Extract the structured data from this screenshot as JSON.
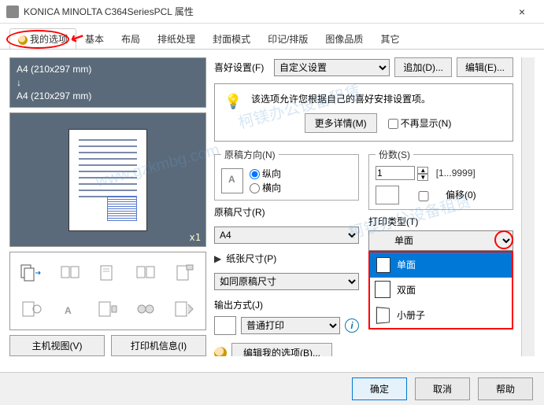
{
  "window": {
    "title": "KONICA MINOLTA C364SeriesPCL 属性",
    "close": "×"
  },
  "tabs": [
    "我的选项",
    "基本",
    "布局",
    "排纸处理",
    "封面模式",
    "印记/排版",
    "图像品质",
    "其它"
  ],
  "active_tab": 0,
  "preview": {
    "line1": "A4 (210x297 mm)",
    "line2": "A4 (210x297 mm)",
    "arrow": "↓",
    "scale": "x1"
  },
  "left_buttons": {
    "host": "主机视图(V)",
    "info": "打印机信息(I)"
  },
  "fav": {
    "label": "喜好设置(F)",
    "selected": "自定义设置",
    "add": "追加(D)...",
    "edit": "编辑(E)..."
  },
  "tip": {
    "text": "该选项允许您根据自己的喜好安排设置项。",
    "more": "更多详情(M)",
    "hide": "不再显示(N)"
  },
  "orientation": {
    "legend": "原稿方向(N)",
    "portrait": "纵向",
    "landscape": "横向"
  },
  "orig_size": {
    "label": "原稿尺寸(R)",
    "value": "A4"
  },
  "paper_size": {
    "label": "纸张尺寸(P)",
    "value": "如同原稿尺寸"
  },
  "output": {
    "label": "输出方式(J)",
    "value": "普通打印"
  },
  "copies": {
    "legend": "份数(S)",
    "value": "1",
    "range": "[1...9999]",
    "collate": "偏移(0)"
  },
  "print_type": {
    "label": "打印类型(T)",
    "selected": "单面",
    "options": [
      "单面",
      "双面",
      "小册子"
    ]
  },
  "edit_mine": "编辑我的选项(B)...",
  "footer": {
    "ok": "确定",
    "cancel": "取消",
    "help": "帮助"
  }
}
